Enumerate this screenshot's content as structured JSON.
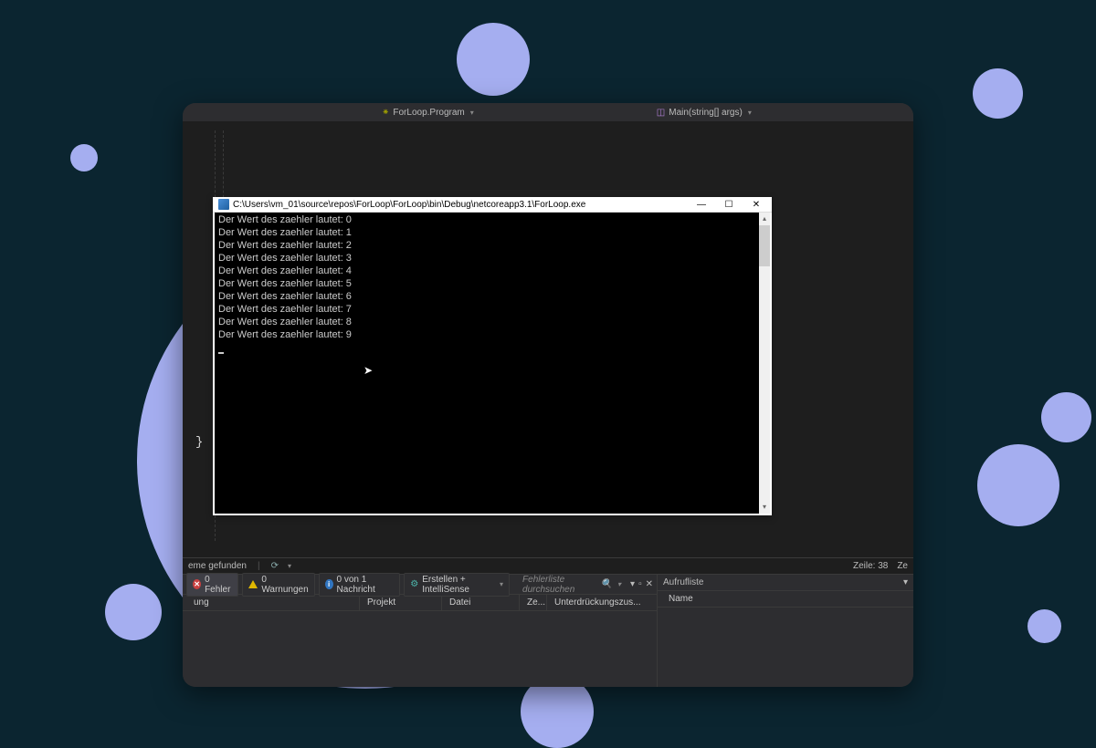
{
  "background": {
    "color": "#0b2530",
    "accent_circle_color": "#a5aef0"
  },
  "ide": {
    "breadcrumb_class": "ForLoop.Program",
    "breadcrumb_method": "Main(string[] args)",
    "code_brace": "}",
    "status": {
      "found_text": "eme gefunden",
      "line_label": "Zeile: 38",
      "col_label": "Ze"
    },
    "error_list": {
      "errors": {
        "label": "0 Fehler"
      },
      "warnings": {
        "label": "0 Warnungen"
      },
      "messages": {
        "label": "0 von 1 Nachricht"
      },
      "build_filter": "Erstellen + IntelliSense",
      "search_placeholder": "Fehlerliste durchsuchen",
      "columns": {
        "code": "ung",
        "project": "Projekt",
        "file": "Datei",
        "line": "Ze...",
        "suppress": "Unterdrückungszus..."
      }
    },
    "callstack": {
      "title": "Aufrufliste",
      "name_col": "Name"
    }
  },
  "console": {
    "title": "C:\\Users\\vm_01\\source\\repos\\ForLoop\\ForLoop\\bin\\Debug\\netcoreapp3.1\\ForLoop.exe",
    "window_controls": {
      "minimize": "—",
      "maximize": "☐",
      "close": "✕"
    },
    "lines": [
      "Der Wert des zaehler lautet: 0",
      "Der Wert des zaehler lautet: 1",
      "Der Wert des zaehler lautet: 2",
      "Der Wert des zaehler lautet: 3",
      "Der Wert des zaehler lautet: 4",
      "Der Wert des zaehler lautet: 5",
      "Der Wert des zaehler lautet: 6",
      "Der Wert des zaehler lautet: 7",
      "Der Wert des zaehler lautet: 8",
      "Der Wert des zaehler lautet: 9"
    ]
  }
}
